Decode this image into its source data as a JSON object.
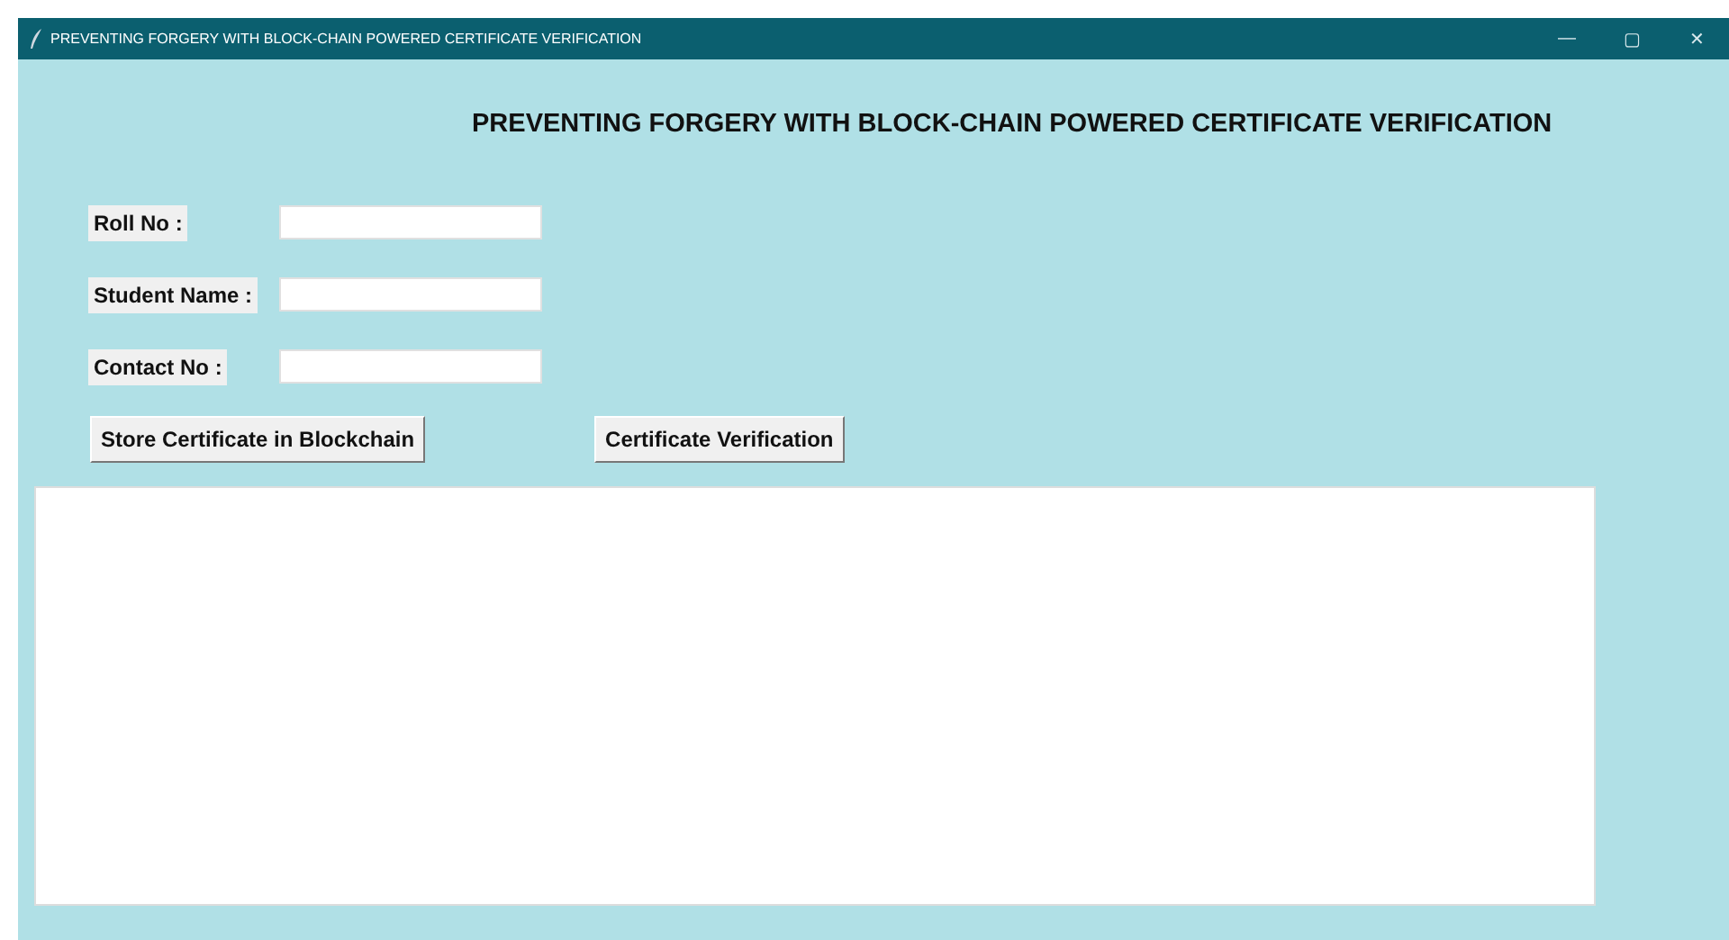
{
  "window": {
    "title": "PREVENTING FORGERY WITH BLOCK-CHAIN POWERED CERTIFICATE VERIFICATION",
    "controls": [
      "—",
      "▢",
      "✕"
    ]
  },
  "heading": "PREVENTING FORGERY WITH BLOCK-CHAIN POWERED CERTIFICATE VERIFICATION",
  "fields": [
    {
      "label": "Roll No :"
    },
    {
      "label": "Student Name :"
    },
    {
      "label": "Contact No :"
    }
  ],
  "buttons": [
    {
      "label": "Store Certificate in Blockchain"
    },
    {
      "label": "Certificate Verification"
    }
  ]
}
